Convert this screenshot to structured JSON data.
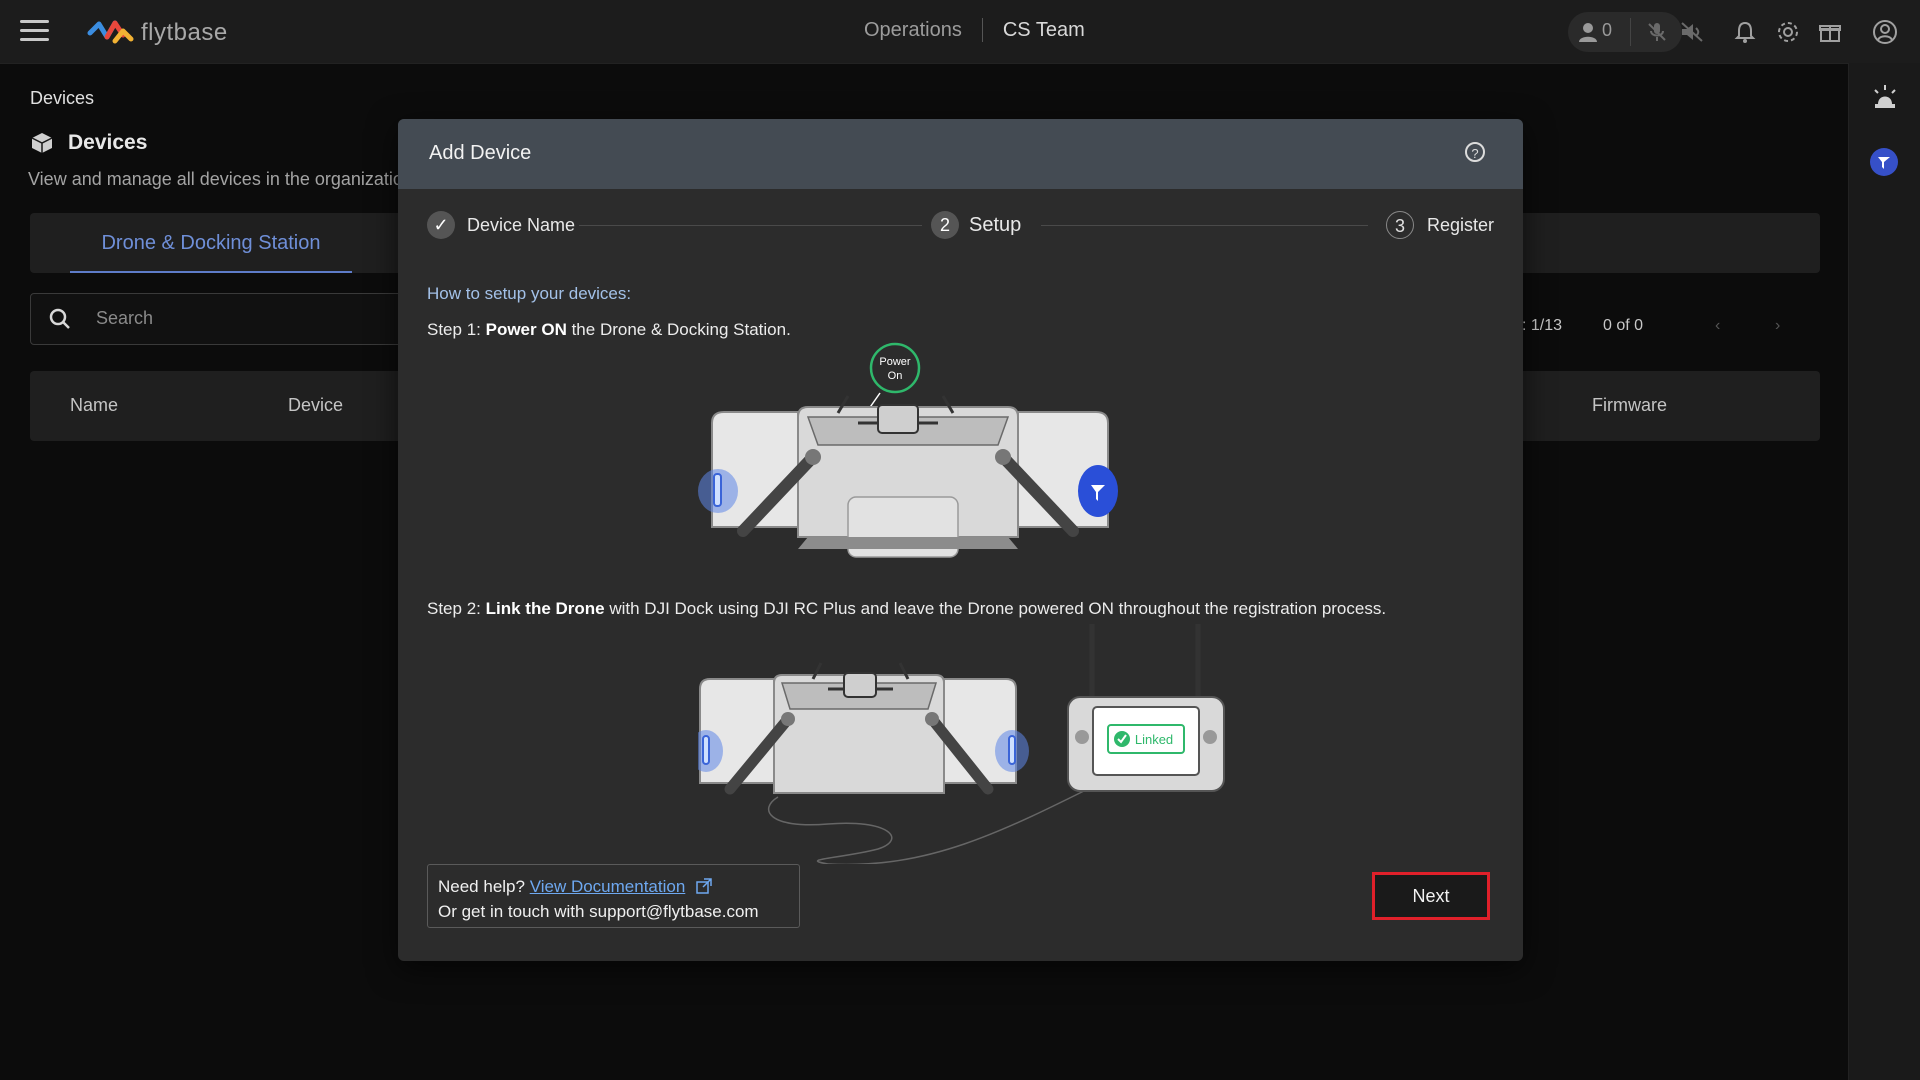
{
  "topbar": {
    "brand": "flytbase",
    "nav_operations": "Operations",
    "nav_team": "CS Team",
    "user_count": "0"
  },
  "page": {
    "breadcrumb": "Devices",
    "title": "Devices",
    "description": "View and manage all devices in the organization",
    "active_tab": "Drone & Docking Station",
    "search_placeholder": "Search",
    "pager_page": ": 1/13",
    "pager_count": "0 of 0",
    "columns": [
      "Name",
      "Device",
      "Firmware"
    ]
  },
  "modal": {
    "title": "Add Device",
    "steps": [
      {
        "number": "✓",
        "label": "Device Name",
        "state": "done"
      },
      {
        "number": "2",
        "label": "Setup",
        "state": "active"
      },
      {
        "number": "3",
        "label": "Register",
        "state": "pending"
      }
    ],
    "how_to": "How to setup your devices:",
    "step1_prefix": "Step 1: ",
    "step1_bold": "Power ON",
    "step1_rest": " the Drone & Docking Station.",
    "power_on_label": "Power On",
    "step2_prefix": "Step 2: ",
    "step2_bold": "Link the Drone",
    "step2_rest": " with DJI Dock using DJI RC Plus and leave the Drone powered ON throughout the registration process.",
    "linked_label": "Linked",
    "help_prefix": "Need help? ",
    "help_link": "View Documentation",
    "help_contact": "Or get in touch with support@flytbase.com",
    "next_label": "Next"
  },
  "colors": {
    "accent_blue": "#5e7cc9",
    "next_outline": "#e0202a",
    "power_green": "#2fb86b"
  }
}
